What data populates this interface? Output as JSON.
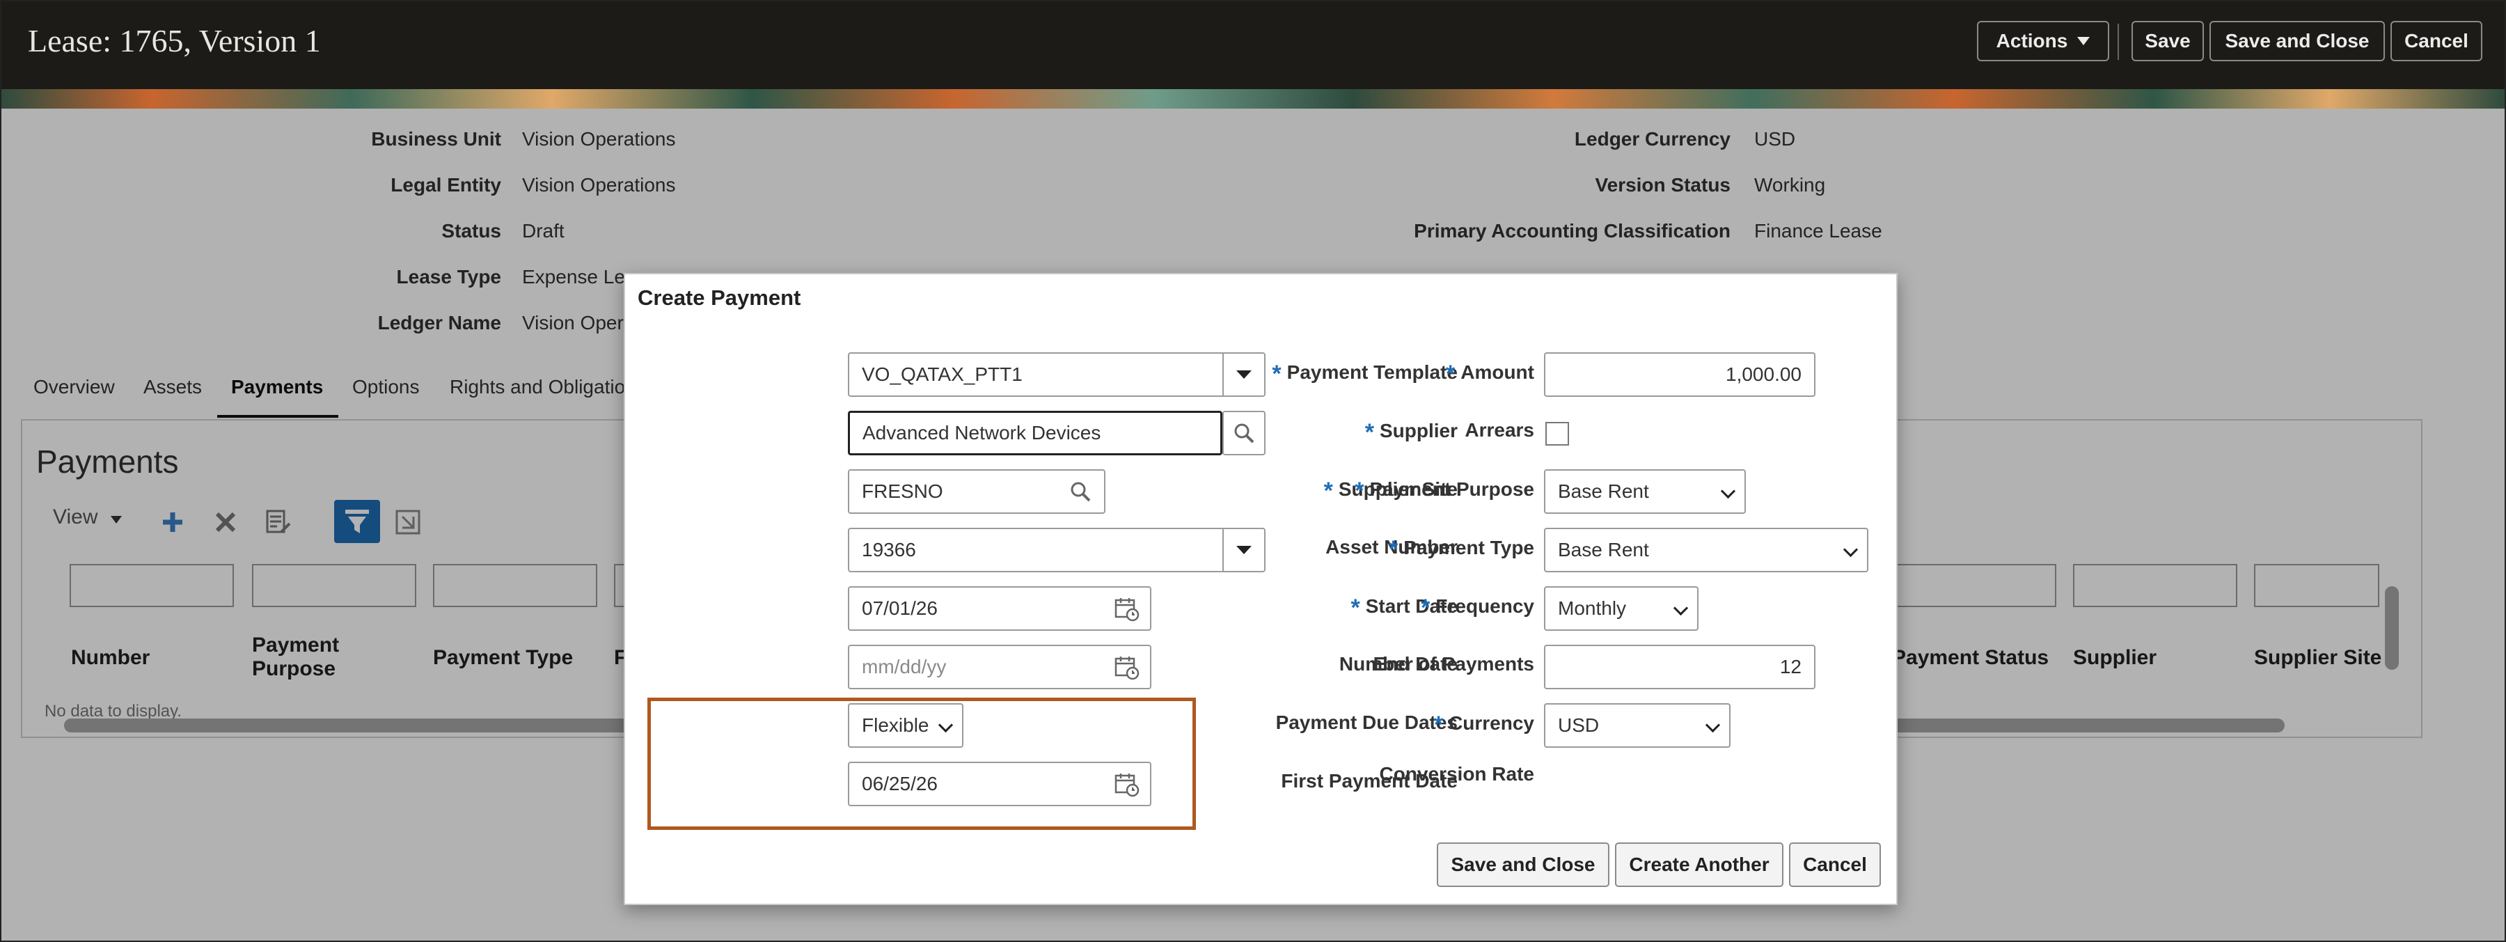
{
  "header": {
    "title": "Lease: 1765, Version 1",
    "actions_label": "Actions",
    "save_label": "Save",
    "save_close_label": "Save and Close",
    "cancel_label": "Cancel"
  },
  "summary": {
    "left": [
      {
        "label": "Business Unit",
        "value": "Vision Operations"
      },
      {
        "label": "Legal Entity",
        "value": "Vision Operations"
      },
      {
        "label": "Status",
        "value": "Draft"
      },
      {
        "label": "Lease Type",
        "value": "Expense Le"
      },
      {
        "label": "Ledger Name",
        "value": "Vision Oper"
      }
    ],
    "right": [
      {
        "label": "Ledger Currency",
        "value": "USD"
      },
      {
        "label": "Version Status",
        "value": "Working"
      },
      {
        "label": "Primary Accounting Classification",
        "value": "Finance Lease"
      }
    ]
  },
  "tabs": [
    "Overview",
    "Assets",
    "Payments",
    "Options",
    "Rights and Obligatio"
  ],
  "payments_panel": {
    "title": "Payments",
    "view_label": "View",
    "columns": [
      "Number",
      "Payment Purpose",
      "Payment Type",
      "F",
      "Payment Status",
      "Supplier",
      "Supplier Site"
    ],
    "no_data": "No data to display."
  },
  "dialog": {
    "title": "Create Payment",
    "left_fields": {
      "payment_template": {
        "label": "Payment Template",
        "value": "VO_QATAX_PTT1"
      },
      "supplier": {
        "label": "Supplier",
        "value": "Advanced Network Devices"
      },
      "supplier_site": {
        "label": "Supplier Site",
        "value": "FRESNO"
      },
      "asset_number": {
        "label": "Asset Number",
        "value": "19366"
      },
      "start_date": {
        "label": "Start Date",
        "value": "07/01/26"
      },
      "end_date": {
        "label": "End Date",
        "placeholder": "mm/dd/yy"
      },
      "payment_due_dates": {
        "label": "Payment Due Dates",
        "value": "Flexible"
      },
      "first_payment_date": {
        "label": "First Payment Date",
        "value": "06/25/26"
      }
    },
    "right_fields": {
      "amount": {
        "label": "Amount",
        "value": "1,000.00"
      },
      "arrears": {
        "label": "Arrears"
      },
      "payment_purpose": {
        "label": "Payment Purpose",
        "value": "Base Rent"
      },
      "payment_type": {
        "label": "Payment Type",
        "value": "Base Rent"
      },
      "frequency": {
        "label": "Frequency",
        "value": "Monthly"
      },
      "number_of_payments": {
        "label": "Number of Payments",
        "value": "12"
      },
      "currency": {
        "label": "Currency",
        "value": "USD"
      },
      "conversion_rate": {
        "label": "Conversion Rate"
      }
    },
    "buttons": {
      "save_close": "Save and Close",
      "create_another": "Create Another",
      "cancel": "Cancel"
    },
    "required_marker": "*"
  },
  "colors": {
    "header_bg": "#1c1b18",
    "required_star": "#1f6eb5",
    "highlight_border": "#b0581f",
    "toolbar_blue": "#1f6eb5"
  },
  "icons": [
    "search-icon",
    "calendar-icon",
    "dropdown-arrow-icon",
    "add-icon",
    "delete-icon",
    "edit-icon",
    "filter-icon",
    "detach-icon"
  ]
}
